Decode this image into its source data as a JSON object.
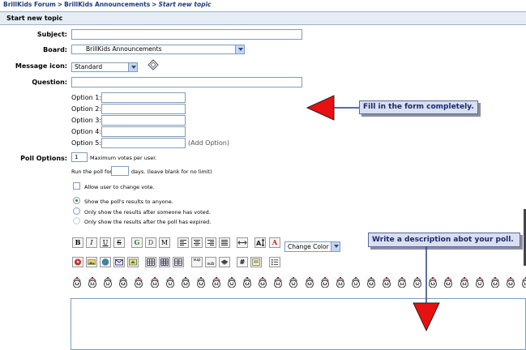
{
  "breadcrumb": {
    "forum": "BrillKids Forum",
    "board": "BrillKids Announcements",
    "current": "Start new topic",
    "separator": ">"
  },
  "page_title": "Start new topic",
  "form": {
    "subject_label": "Subject:",
    "subject_value": "",
    "board_label": "Board:",
    "board_value": "BrillKids Announcements",
    "icon_label": "Message icon:",
    "icon_value": "Standard",
    "question_label": "Question:",
    "question_value": "",
    "options": [
      {
        "label": "Option 1:",
        "value": ""
      },
      {
        "label": "Option 2:",
        "value": ""
      },
      {
        "label": "Option 3:",
        "value": ""
      },
      {
        "label": "Option 4:",
        "value": ""
      },
      {
        "label": "Option 5:",
        "value": ""
      }
    ],
    "add_option": "(Add Option)",
    "poll_options_label": "Poll Options:",
    "max_votes_value": "1",
    "max_votes_text": "Maximum votes per user.",
    "run_for_prefix": "Run the poll for",
    "run_for_value": "",
    "run_for_suffix": "days. (leave blank for no limit)",
    "allow_change_text": "Allow user to change vote.",
    "results": [
      {
        "text": "Show the poll's results to anyone.",
        "checked": true,
        "disabled": false
      },
      {
        "text": "Only show the results after someone has voted.",
        "checked": false,
        "disabled": false
      },
      {
        "text": "Only show the results after the poll has expired.",
        "checked": false,
        "disabled": true
      }
    ]
  },
  "toolbar": {
    "row1": [
      "B",
      "I",
      "U",
      "S",
      "G",
      "D",
      "M",
      "left",
      "center",
      "right",
      "justify",
      "hr",
      "size",
      "A"
    ],
    "change_color": "Change Color",
    "row2": [
      "flash",
      "img",
      "url",
      "email",
      "ftp",
      "table",
      "tr",
      "td",
      "sup",
      "sub",
      "tt",
      "code",
      "quote",
      "list"
    ]
  },
  "smiley_count": 30,
  "callouts": {
    "fill_form": "Fill in the form completely.",
    "write_desc": "Write a description abot your poll."
  },
  "colors": {
    "arrow_red": "#e81010",
    "link_blue": "#1f3a7a",
    "title_bg": "#e6ecf4",
    "callout_bg": "#d9dff0"
  }
}
